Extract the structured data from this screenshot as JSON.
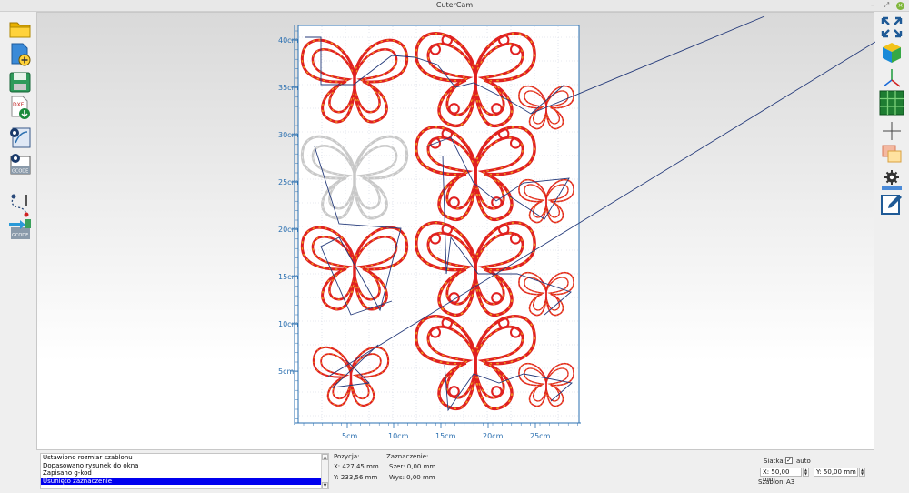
{
  "window": {
    "title": "CuterCam"
  },
  "chart": {
    "y_ticks": [
      "40cm",
      "35cm",
      "30cm",
      "25cm",
      "20cm",
      "15cm",
      "10cm",
      "5cm"
    ],
    "x_ticks": [
      "5cm",
      "10cm",
      "15cm",
      "20cm",
      "25cm"
    ]
  },
  "log": {
    "entries": [
      "Ustawiono rozmiar szablonu",
      "Dopasowano rysunek do okna",
      "Zapisano g-kod",
      "Usunięto zaznaczenie"
    ],
    "selected_index": 3
  },
  "position": {
    "label": "Pozycja:",
    "x": "X: 427,45 mm",
    "y": "Y: 233,56 mm"
  },
  "selection": {
    "label": "Zaznaczenie:",
    "width": "Szer: 0,00 mm",
    "height": "Wys: 0,00 mm"
  },
  "grid": {
    "label": "Siatka:",
    "auto_label": "auto",
    "auto_checked": true,
    "x_value": "X: 50,00 mm",
    "y_value": "Y: 50,00 mm",
    "template_label": "Szablon:",
    "template_value": "A3"
  },
  "toolbar_left": [
    "open-folder-icon",
    "new-file-icon",
    "save-icon",
    "export-dxf-icon",
    "settings-path-icon",
    "generate-gcode-icon",
    "path-order-icon",
    "send-gcode-icon"
  ],
  "toolbar_left_labels": {
    "dxf": "DXF",
    "gcode": "GCODE"
  },
  "toolbar_right": [
    "fit-to-window-icon",
    "3d-view-icon",
    "axes-icon",
    "grid-toggle-icon",
    "crosshair-icon",
    "template-icon",
    "machine-settings-icon",
    "edit-icon"
  ],
  "colors": {
    "accent": "#2a6fb0",
    "cut_path": "#e02020",
    "cut_path_dash": "#f0a020",
    "travel_path": "#243a7a",
    "selection": "#0000ee",
    "grid_green": "#1e7d32"
  }
}
